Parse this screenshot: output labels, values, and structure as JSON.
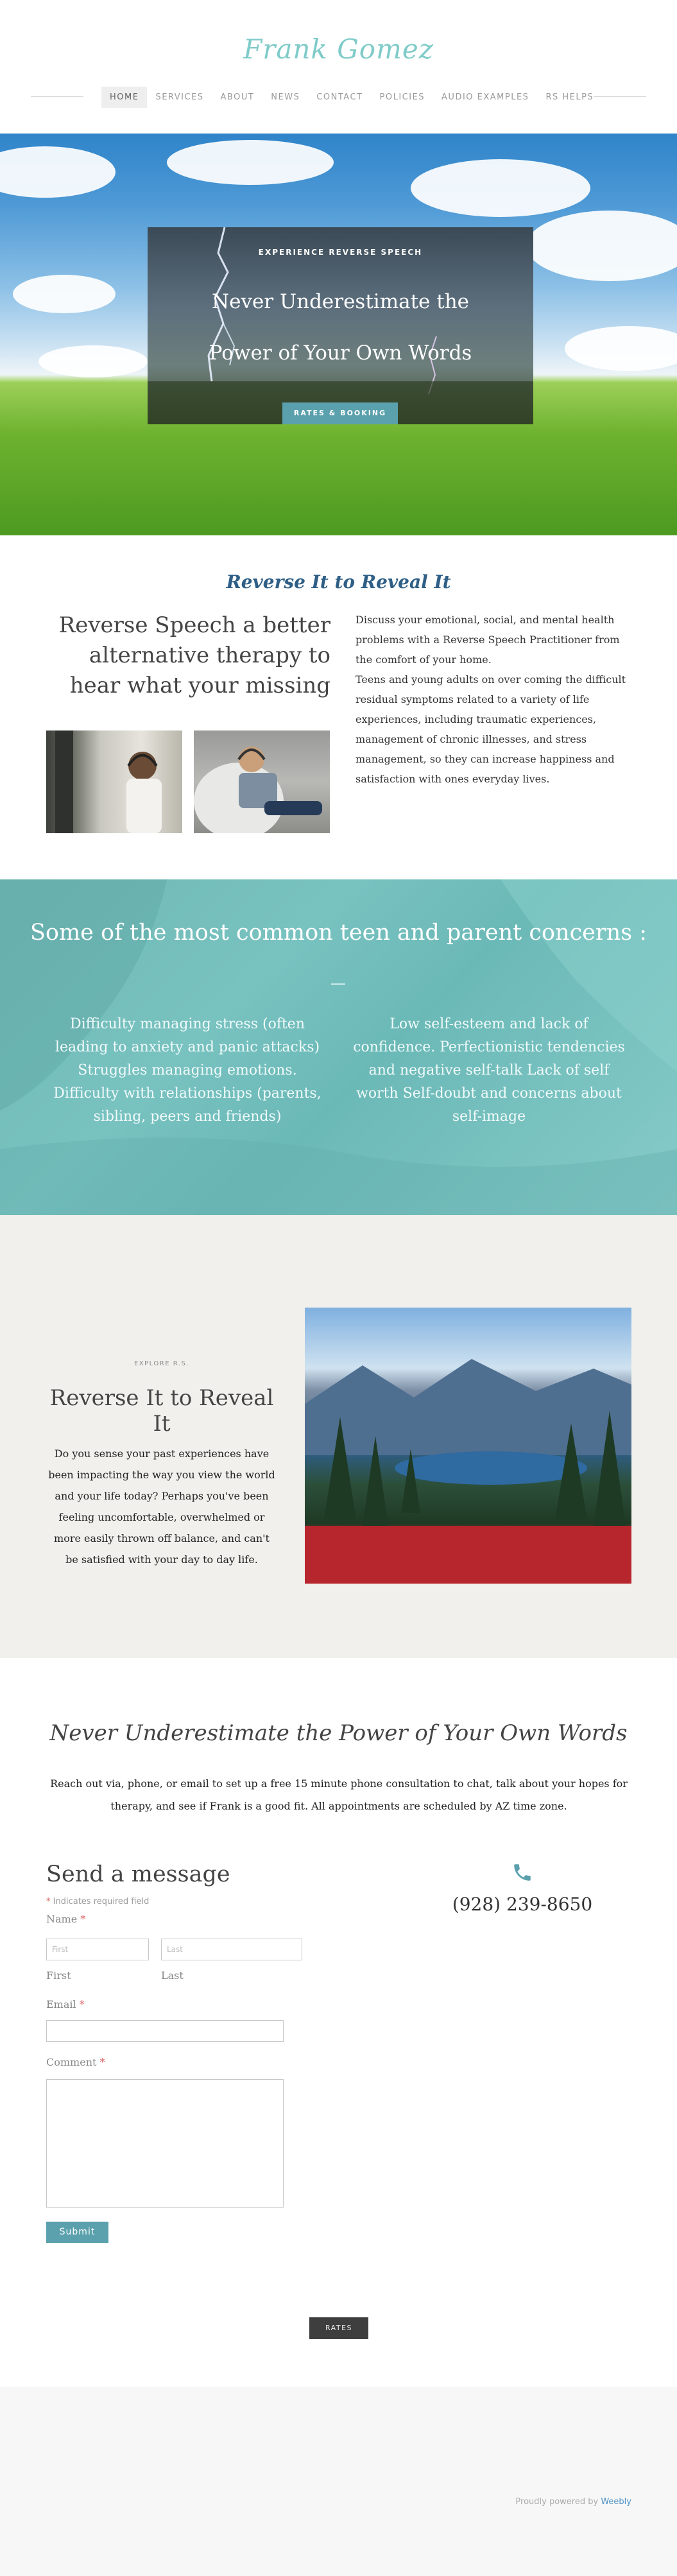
{
  "site": {
    "logo": "Frank Gomez"
  },
  "nav": {
    "items": [
      {
        "label": "HOME",
        "active": true
      },
      {
        "label": "SERVICES"
      },
      {
        "label": "ABOUT"
      },
      {
        "label": "NEWS"
      },
      {
        "label": "CONTACT"
      },
      {
        "label": "POLICIES"
      },
      {
        "label": "AUDIO EXAMPLES"
      },
      {
        "label": "RS HELPS"
      }
    ]
  },
  "hero": {
    "eyebrow": "EXPERIENCE REVERSE SPEECH",
    "title_line1": "Never Underestimate the",
    "title_line2": "Power of Your Own Words",
    "button": "RATES & BOOKING"
  },
  "intro": {
    "title": "Reverse It to Reveal It",
    "heading": "Reverse Speech a better alternative therapy to hear what your missing",
    "paragraph1": "Discuss your emotional, social, and mental health problems with a Reverse Speech Practitioner from the comfort of your home.",
    "paragraph2": "Teens and young adults on over coming the difficult residual symptoms related to a variety of life experiences, including traumatic experiences, management of chronic illnesses, and stress management, so they can increase happiness and satisfaction with ones everyday lives."
  },
  "concerns": {
    "title": "Some of the most common teen and parent concerns :",
    "left": "Difficulty managing stress (often leading to anxiety and panic attacks) Struggles managing emotions. Difficulty with relationships (parents, sibling, peers and friends)",
    "right": "Low self-esteem and lack of confidence. Perfectionistic tendencies and negative self-talk Lack of self worth Self-doubt and concerns about self-image"
  },
  "explore": {
    "eyebrow": "EXPLORE R.S.",
    "title": "Reverse It to Reveal It",
    "body": "Do you sense your past experiences have been impacting the way you view the world and your life today? Perhaps you've been feeling uncomfortable, overwhelmed or more easily thrown off balance, and can't be satisfied with your day to day life."
  },
  "contact": {
    "title": "Never Underestimate the Power of Your Own Words",
    "body": "Reach out via, phone, or email to set up a free 15 minute phone consultation to chat, talk about your hopes for therapy, and see if Frank is a good fit. All appointments are scheduled by AZ time zone.",
    "form_title": "Send a message",
    "required_note": "Indicates required field",
    "name_label": "Name",
    "first_placeholder": "First",
    "last_placeholder": "Last",
    "first_sub": "First",
    "last_sub": "Last",
    "email_label": "Email",
    "comment_label": "Comment",
    "submit": "Submit",
    "phone": "(928) 239-8650"
  },
  "rates_button": "RATES",
  "footer": {
    "powered_prefix": "Proudly powered by",
    "powered_brand": "Weebly"
  },
  "colors": {
    "accent": "#5aa0ad",
    "logo": "#7fcbc9",
    "intro_title": "#2f5f86",
    "teal_band": "#74bfbd"
  },
  "icons": [
    "phone-icon",
    "lightning-bolt-decoration"
  ]
}
